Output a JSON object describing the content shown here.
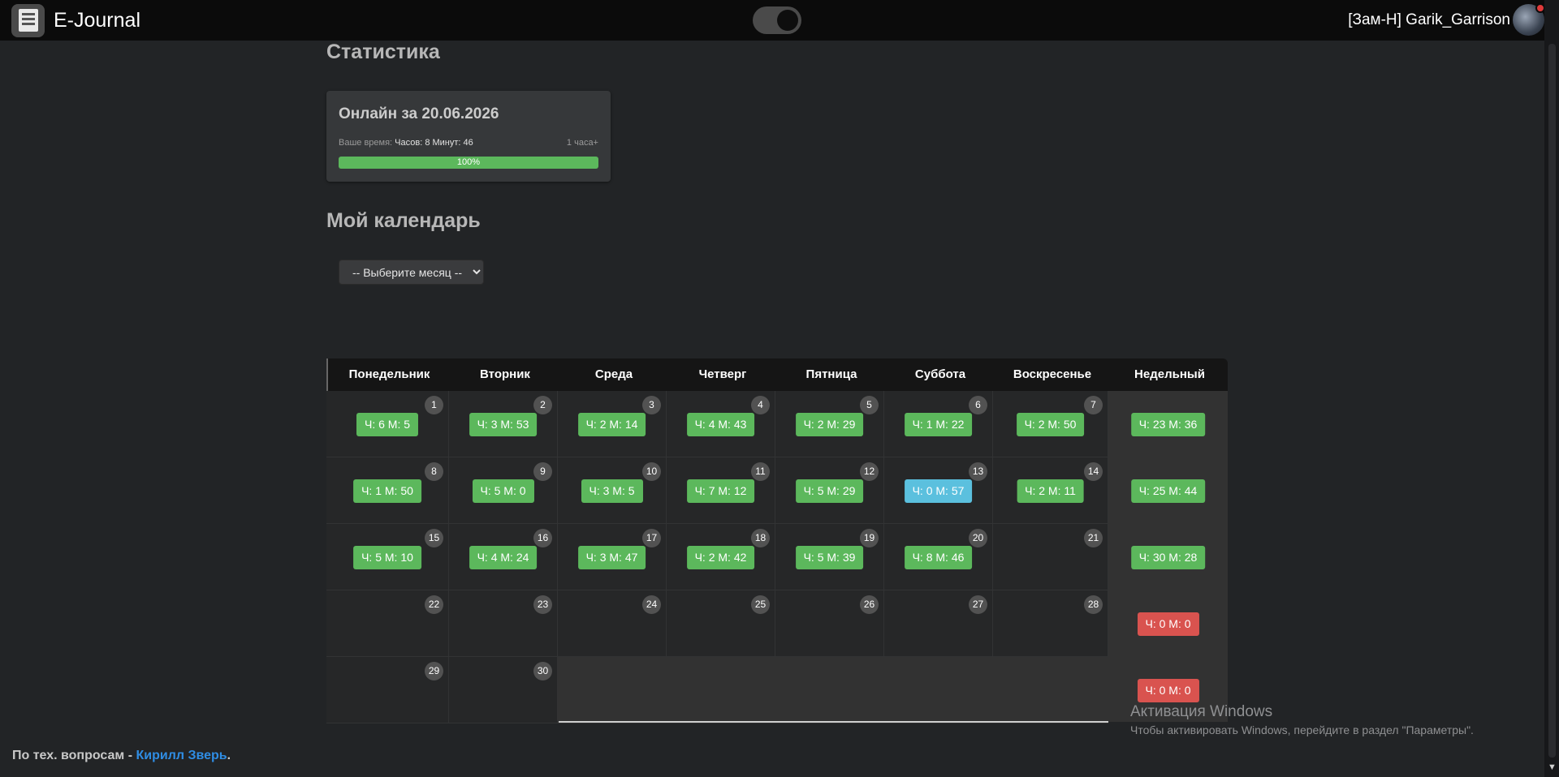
{
  "navbar": {
    "brand_title": "E-Journal",
    "user_name": "[Зам-Н] Garik_Garrison",
    "theme_toggle_state": "dark"
  },
  "stats": {
    "heading": "Статистика",
    "card_title": "Онлайн за 20.06.2026",
    "time_label": "Ваше время:",
    "time_value": "Часов: 8 Минут: 46",
    "goal_label": "1 часа+",
    "progress_percent": 100,
    "progress_text": "100%"
  },
  "calendar": {
    "heading": "Мой календарь",
    "month_select_value": "-- Выберите месяц --",
    "headers": [
      "Понедельник",
      "Вторник",
      "Среда",
      "Четверг",
      "Пятница",
      "Суббота",
      "Воскресенье",
      "Недельный"
    ],
    "weeks": [
      {
        "days": [
          {
            "day": "1",
            "value": "Ч: 6 М: 5",
            "status": "green"
          },
          {
            "day": "2",
            "value": "Ч: 3 М: 53",
            "status": "green"
          },
          {
            "day": "3",
            "value": "Ч: 2 М: 14",
            "status": "green"
          },
          {
            "day": "4",
            "value": "Ч: 4 М: 43",
            "status": "green"
          },
          {
            "day": "5",
            "value": "Ч: 2 М: 29",
            "status": "green"
          },
          {
            "day": "6",
            "value": "Ч: 1 М: 22",
            "status": "green"
          },
          {
            "day": "7",
            "value": "Ч: 2 М: 50",
            "status": "green"
          }
        ],
        "weekly": {
          "value": "Ч: 23 М: 36",
          "status": "green"
        }
      },
      {
        "days": [
          {
            "day": "8",
            "value": "Ч: 1 М: 50",
            "status": "green"
          },
          {
            "day": "9",
            "value": "Ч: 5 М: 0",
            "status": "green"
          },
          {
            "day": "10",
            "value": "Ч: 3 М: 5",
            "status": "green"
          },
          {
            "day": "11",
            "value": "Ч: 7 М: 12",
            "status": "green"
          },
          {
            "day": "12",
            "value": "Ч: 5 М: 29",
            "status": "green"
          },
          {
            "day": "13",
            "value": "Ч: 0 М: 57",
            "status": "blue"
          },
          {
            "day": "14",
            "value": "Ч: 2 М: 11",
            "status": "green"
          }
        ],
        "weekly": {
          "value": "Ч: 25 М: 44",
          "status": "green"
        }
      },
      {
        "days": [
          {
            "day": "15",
            "value": "Ч: 5 М: 10",
            "status": "green"
          },
          {
            "day": "16",
            "value": "Ч: 4 М: 24",
            "status": "green"
          },
          {
            "day": "17",
            "value": "Ч: 3 М: 47",
            "status": "green"
          },
          {
            "day": "18",
            "value": "Ч: 2 М: 42",
            "status": "green"
          },
          {
            "day": "19",
            "value": "Ч: 5 М: 39",
            "status": "green"
          },
          {
            "day": "20",
            "value": "Ч: 8 М: 46",
            "status": "green"
          },
          {
            "day": "21",
            "value": "",
            "status": ""
          }
        ],
        "weekly": {
          "value": "Ч: 30 М: 28",
          "status": "green"
        }
      },
      {
        "days": [
          {
            "day": "22",
            "value": "",
            "status": ""
          },
          {
            "day": "23",
            "value": "",
            "status": ""
          },
          {
            "day": "24",
            "value": "",
            "status": ""
          },
          {
            "day": "25",
            "value": "",
            "status": ""
          },
          {
            "day": "26",
            "value": "",
            "status": ""
          },
          {
            "day": "27",
            "value": "",
            "status": ""
          },
          {
            "day": "28",
            "value": "",
            "status": ""
          }
        ],
        "weekly": {
          "value": "Ч: 0 М: 0",
          "status": "red"
        }
      },
      {
        "days": [
          {
            "day": "29",
            "value": "",
            "status": ""
          },
          {
            "day": "30",
            "value": "",
            "status": ""
          }
        ],
        "weekly": {
          "value": "Ч: 0 М: 0",
          "status": "red"
        }
      }
    ]
  },
  "colors": {
    "green": "#5cb85c",
    "blue": "#5bc0de",
    "red": "#d9534f",
    "link": "#2f8de4"
  },
  "windows_activation": {
    "title": "Активация Windows",
    "subtitle": "Чтобы активировать Windows, перейдите в раздел \"Параметры\"."
  },
  "footer": {
    "prefix": "По тех. вопросам - ",
    "link_text": "Кирилл Зверь",
    "suffix": "."
  }
}
